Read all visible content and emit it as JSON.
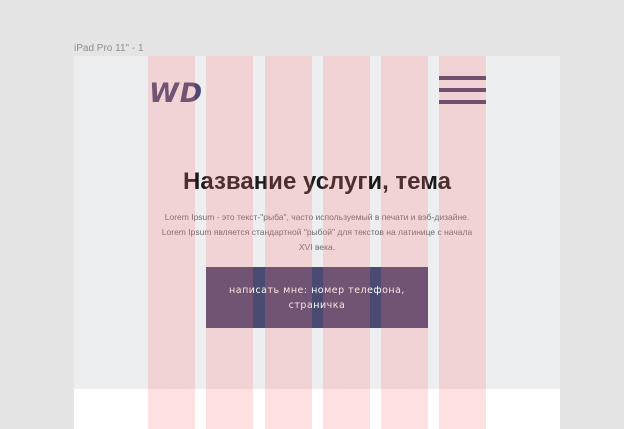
{
  "canvas": {
    "frame_label": "iPad Pro 11\" - 1"
  },
  "header": {
    "logo_text": "WD",
    "menu_icon": "hamburger-menu-icon"
  },
  "hero": {
    "title": "Название услуги, тема",
    "description": "Lorem Ipsum - это текст-\"рыба\", часто используемый в печати и вэб-дизайне. Lorem Ipsum является стандартной \"рыбой\" для текстов на латинице с начала XVI века.",
    "cta_label": "написать мне: номер телефона, страничка"
  },
  "colors": {
    "accent": "#4a4a72",
    "frame_background": "#edeef0",
    "canvas_background": "#e5e5e5",
    "layout_grid": "#ff7878"
  }
}
